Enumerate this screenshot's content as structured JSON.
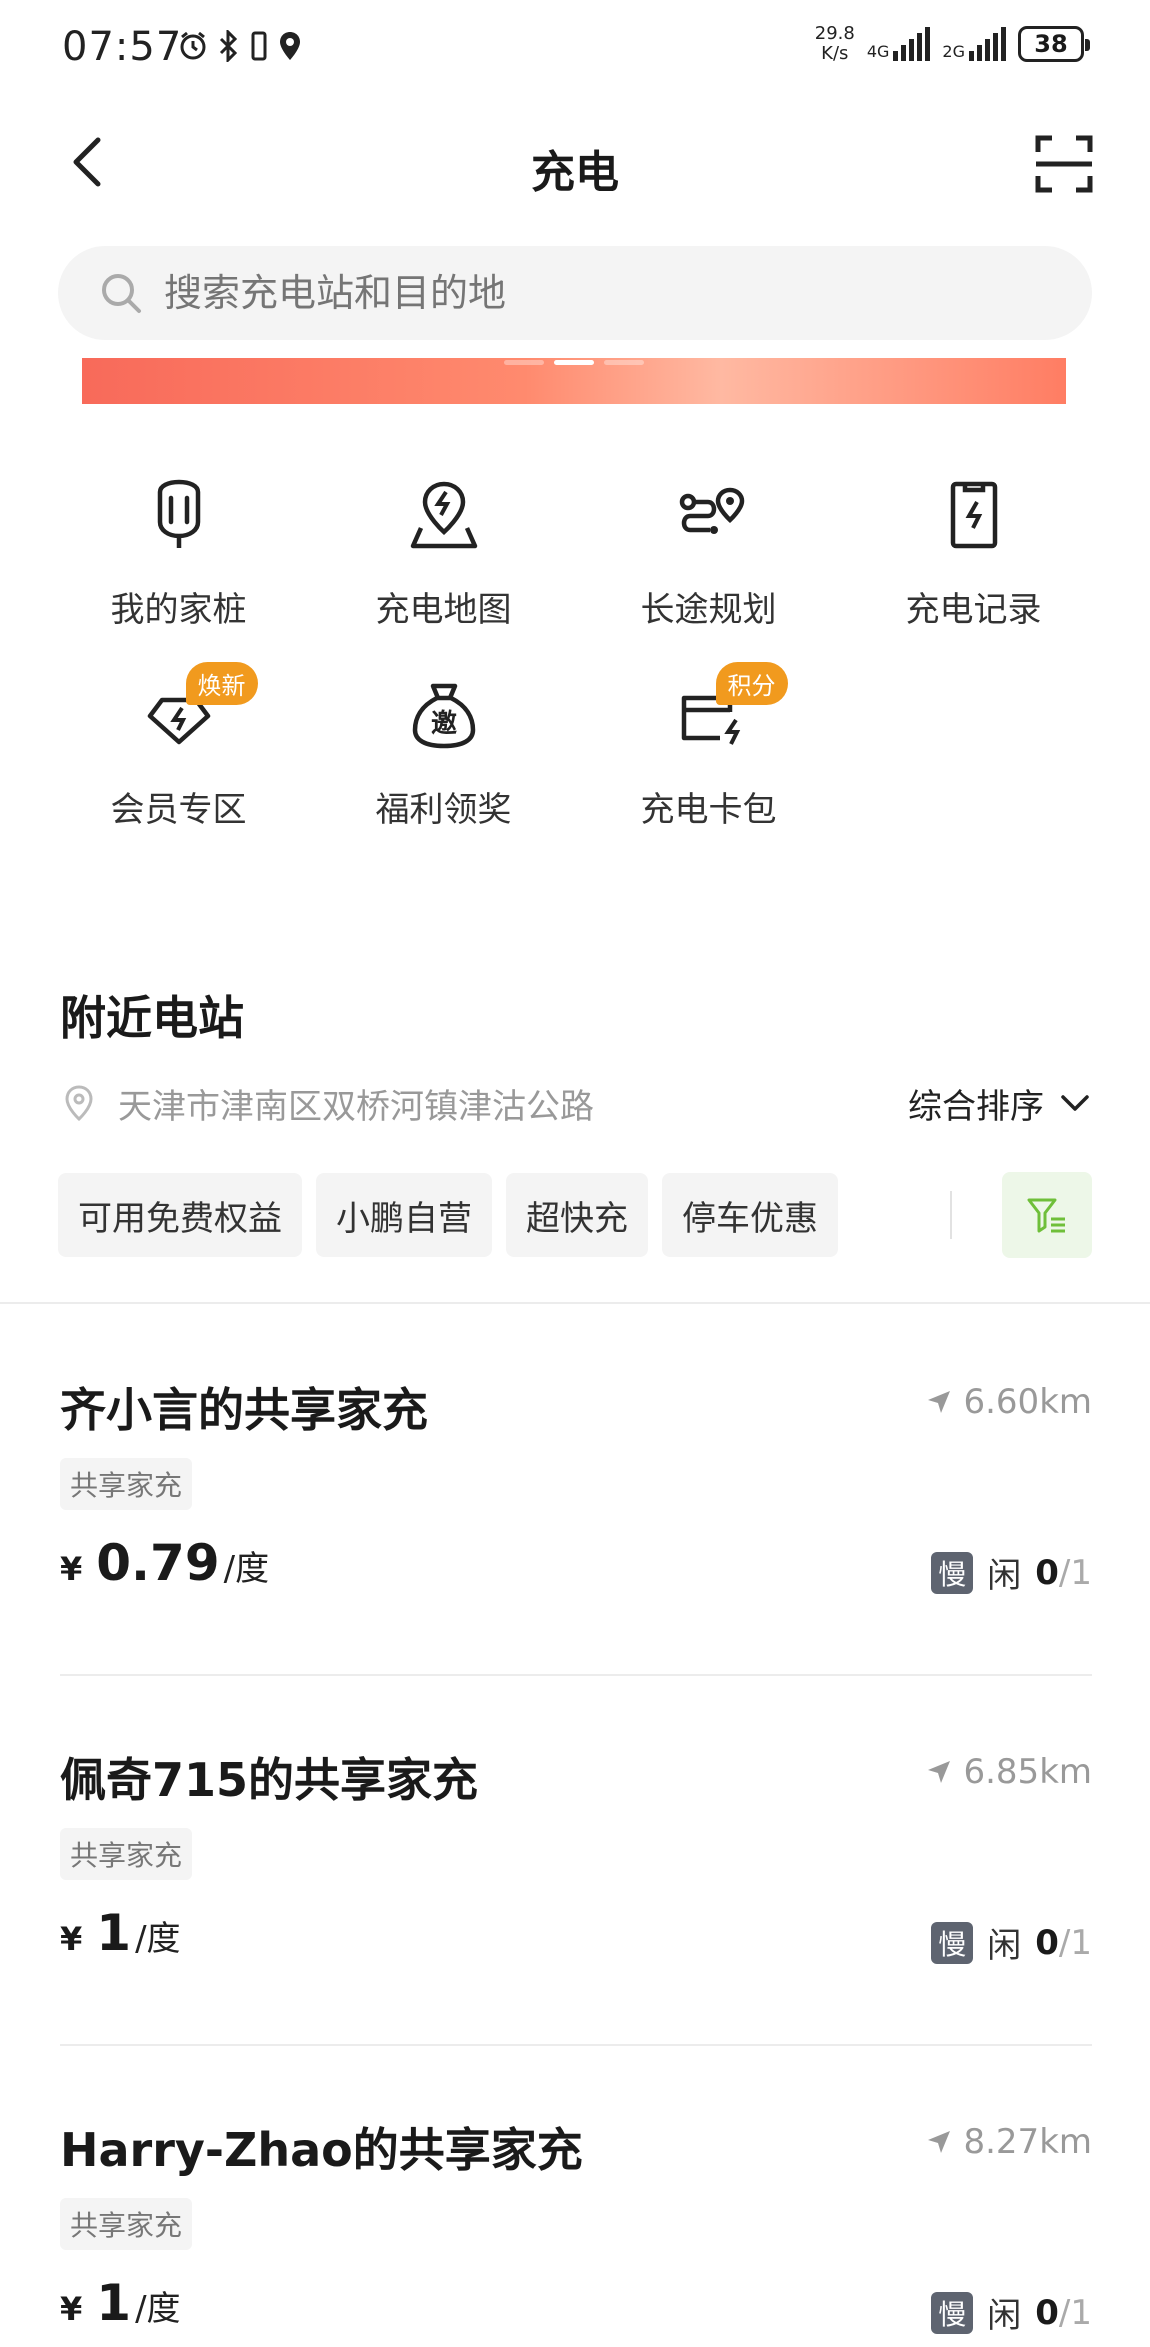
{
  "status_bar": {
    "time": "07:57",
    "speed_value": "29.8",
    "speed_unit": "K/s",
    "net1": "4G",
    "net2": "2G",
    "battery": "38"
  },
  "nav": {
    "title": "充电",
    "back_icon": "back-arrow-icon",
    "scan_icon": "scan-icon"
  },
  "search": {
    "placeholder": "搜索充电站和目的地"
  },
  "colors": {
    "accent_orange": "#f19a1e",
    "filter_green": "#6fbf3a",
    "banner_red": "#f86a5a"
  },
  "quick_menu": [
    {
      "label": "我的家桩",
      "icon": "home-charger-icon",
      "badge": ""
    },
    {
      "label": "充电地图",
      "icon": "charging-map-icon",
      "badge": ""
    },
    {
      "label": "长途规划",
      "icon": "route-planning-icon",
      "badge": ""
    },
    {
      "label": "充电记录",
      "icon": "charging-record-icon",
      "badge": ""
    },
    {
      "label": "会员专区",
      "icon": "member-zone-icon",
      "badge": "焕新"
    },
    {
      "label": "福利领奖",
      "icon": "invite-reward-icon",
      "badge": ""
    },
    {
      "label": "充电卡包",
      "icon": "card-wallet-icon",
      "badge": "积分"
    }
  ],
  "nearby": {
    "title": "附近电站",
    "location": "天津市津南区双桥河镇津沽公路",
    "sort_label": "综合排序",
    "filters": [
      "可用免费权益",
      "小鹏自营",
      "超快充",
      "停车优惠"
    ]
  },
  "stations": [
    {
      "name": "齐小言的共享家充",
      "distance": "6.60km",
      "tag": "共享家充",
      "yen": "¥",
      "price": "0.79",
      "unit": "/度",
      "speed": "慢",
      "idle_label": "闲",
      "idle": "0",
      "total": "/1"
    },
    {
      "name": "佩奇715的共享家充",
      "distance": "6.85km",
      "tag": "共享家充",
      "yen": "¥",
      "price": "1",
      "unit": "/度",
      "speed": "慢",
      "idle_label": "闲",
      "idle": "0",
      "total": "/1"
    },
    {
      "name": "Harry-Zhao的共享家充",
      "distance": "8.27km",
      "tag": "共享家充",
      "yen": "¥",
      "price": "1",
      "unit": "/度",
      "speed": "慢",
      "idle_label": "闲",
      "idle": "0",
      "total": "/1"
    }
  ]
}
